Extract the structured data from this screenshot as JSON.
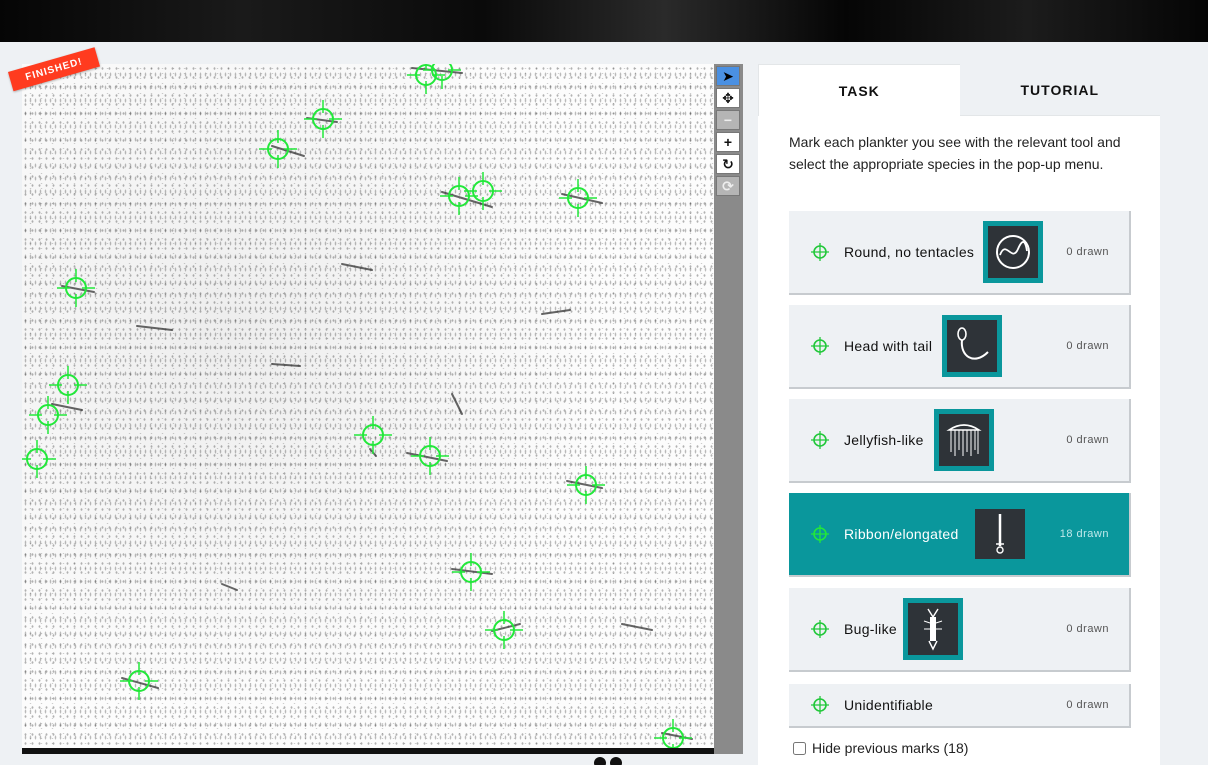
{
  "status": {
    "finished_label": "FINISHED!"
  },
  "tabs": [
    {
      "label": "TASK",
      "active": true
    },
    {
      "label": "TUTORIAL",
      "active": false
    }
  ],
  "instructions": "Mark each plankter you see with the relevant tool and select the appropriate species in the pop-up menu.",
  "tools": [
    {
      "label": "Round, no tentacles",
      "count": "0 drawn",
      "icon": "round-plankton-icon"
    },
    {
      "label": "Head with tail",
      "count": "0 drawn",
      "icon": "head-tail-plankton-icon"
    },
    {
      "label": "Jellyfish-like",
      "count": "0 drawn",
      "icon": "jellyfish-plankton-icon"
    },
    {
      "label": "Ribbon/elongated",
      "count": "18 drawn",
      "icon": "ribbon-plankton-icon",
      "selected": true
    },
    {
      "label": "Bug-like",
      "count": "0 drawn",
      "icon": "bug-plankton-icon"
    },
    {
      "label": "Unidentifiable",
      "count": "0 drawn"
    }
  ],
  "hide_marks": {
    "label": "Hide previous marks (18)",
    "checked": false
  },
  "viewer_tools": [
    "pointer-icon",
    "move-icon",
    "zoom-out-icon",
    "zoom-in-icon",
    "rotate-icon",
    "reset-icon"
  ],
  "colors": {
    "accent": "#0a979c",
    "marker": "#22e83a",
    "finished": "#ff3b1f",
    "active_tool": "#4a90e2"
  }
}
